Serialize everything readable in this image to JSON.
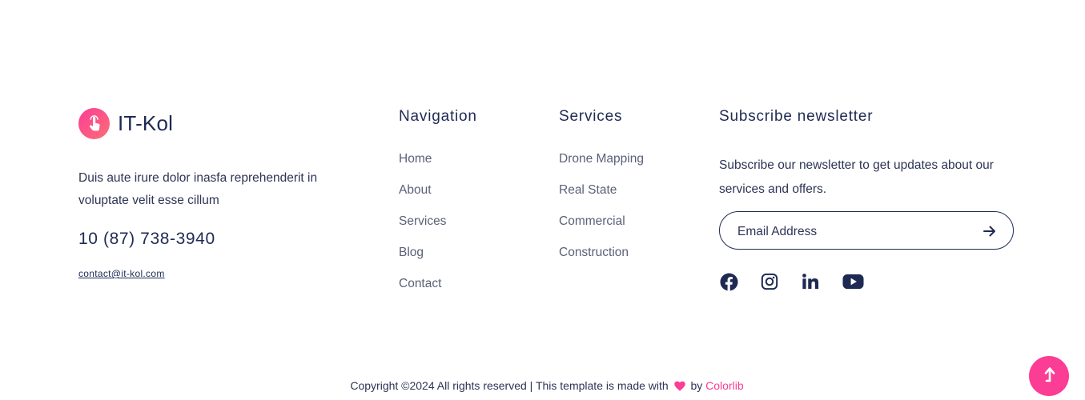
{
  "brand": {
    "name": "IT-Kol",
    "logo_icon": "hand-pointer-icon",
    "accent": "#fb3d95"
  },
  "about": {
    "text": "Duis aute irure dolor inasfa reprehenderit in voluptate velit esse cillum"
  },
  "contact": {
    "phone": "10 (87) 738-3940",
    "email": "contact@it-kol.com"
  },
  "navigation": {
    "title": "Navigation",
    "items": [
      {
        "label": "Home"
      },
      {
        "label": "About"
      },
      {
        "label": "Services"
      },
      {
        "label": "Blog"
      },
      {
        "label": "Contact"
      }
    ]
  },
  "services": {
    "title": "Services",
    "items": [
      {
        "label": "Drone Mapping"
      },
      {
        "label": "Real State"
      },
      {
        "label": "Commercial"
      },
      {
        "label": "Construction"
      }
    ]
  },
  "newsletter": {
    "title": "Subscribe newsletter",
    "text": "Subscribe our newsletter to get updates about our services and offers.",
    "placeholder": "Email Address",
    "value": "",
    "submit_icon": "arrow-right-icon"
  },
  "social": [
    {
      "icon": "facebook-icon"
    },
    {
      "icon": "instagram-icon"
    },
    {
      "icon": "linkedin-icon"
    },
    {
      "icon": "youtube-icon"
    }
  ],
  "footer": {
    "copyright_prefix": "Copyright ©2024 All rights reserved | This template is made with",
    "by_text": "by",
    "credit": "Colorlib",
    "heart_icon": "heart-icon"
  },
  "back_to_top": {
    "icon": "arrow-up-icon"
  },
  "colors": {
    "text": "#1f2a54",
    "muted": "#5b6078",
    "accent": "#fb3d95"
  }
}
